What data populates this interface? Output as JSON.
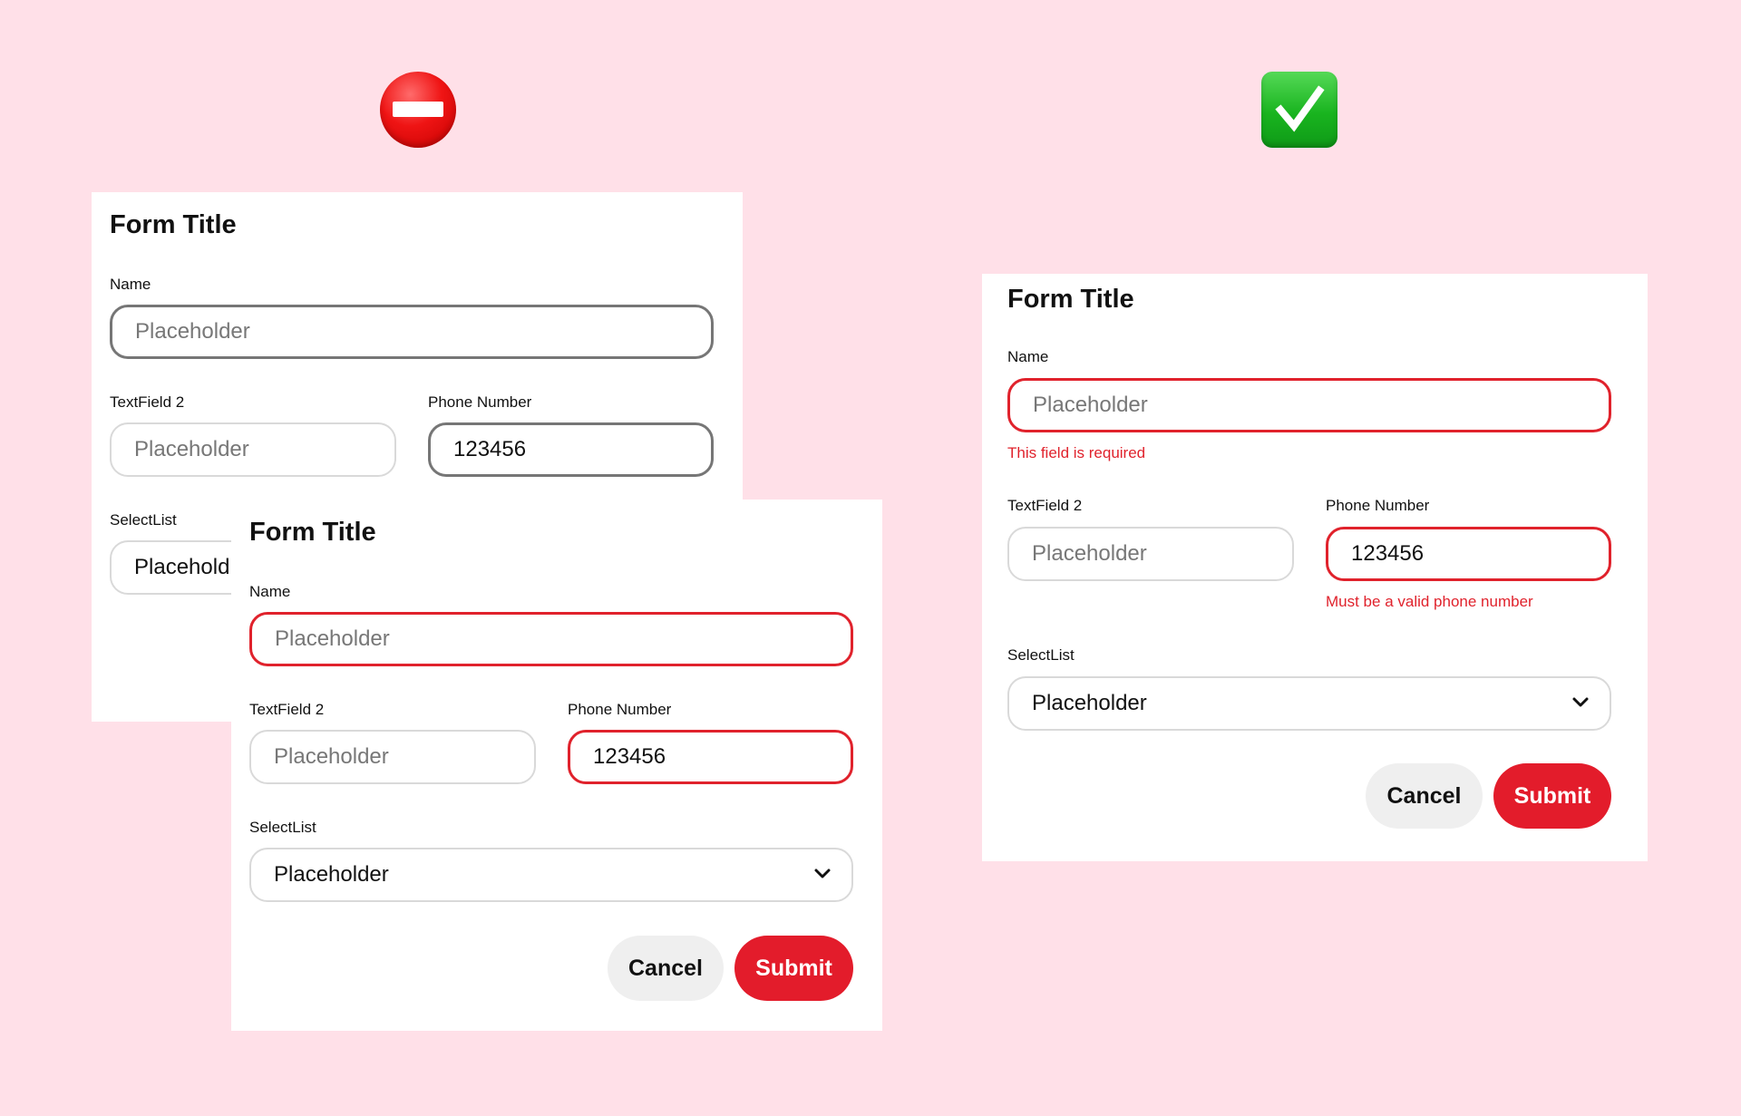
{
  "icons": {
    "bad": "no-entry-icon",
    "good": "check-mark-icon"
  },
  "bad_back_form": {
    "title": "Form Title",
    "name_label": "Name",
    "name_placeholder": "Placeholder",
    "textfield2_label": "TextField 2",
    "textfield2_placeholder": "Placeholder",
    "phone_label": "Phone Number",
    "phone_value": "123456",
    "select_label": "SelectList",
    "select_value": "Placehold"
  },
  "bad_front_form": {
    "title": "Form Title",
    "name_label": "Name",
    "name_placeholder": "Placeholder",
    "textfield2_label": "TextField 2",
    "textfield2_placeholder": "Placeholder",
    "phone_label": "Phone Number",
    "phone_value": "123456",
    "select_label": "SelectList",
    "select_value": "Placeholder",
    "cancel_label": "Cancel",
    "submit_label": "Submit"
  },
  "good_form": {
    "title": "Form Title",
    "name_label": "Name",
    "name_placeholder": "Placeholder",
    "name_error": "This field is required",
    "textfield2_label": "TextField 2",
    "textfield2_placeholder": "Placeholder",
    "phone_label": "Phone Number",
    "phone_value": "123456",
    "phone_error": "Must be a valid phone number",
    "select_label": "SelectList",
    "select_value": "Placeholder",
    "cancel_label": "Cancel",
    "submit_label": "Submit"
  },
  "colors": {
    "background": "#ffe0e8",
    "error": "#e0222c",
    "submit": "#e31c2b",
    "cancel": "#efefef",
    "focus_border": "#767676",
    "default_border": "#d9d9d9"
  }
}
